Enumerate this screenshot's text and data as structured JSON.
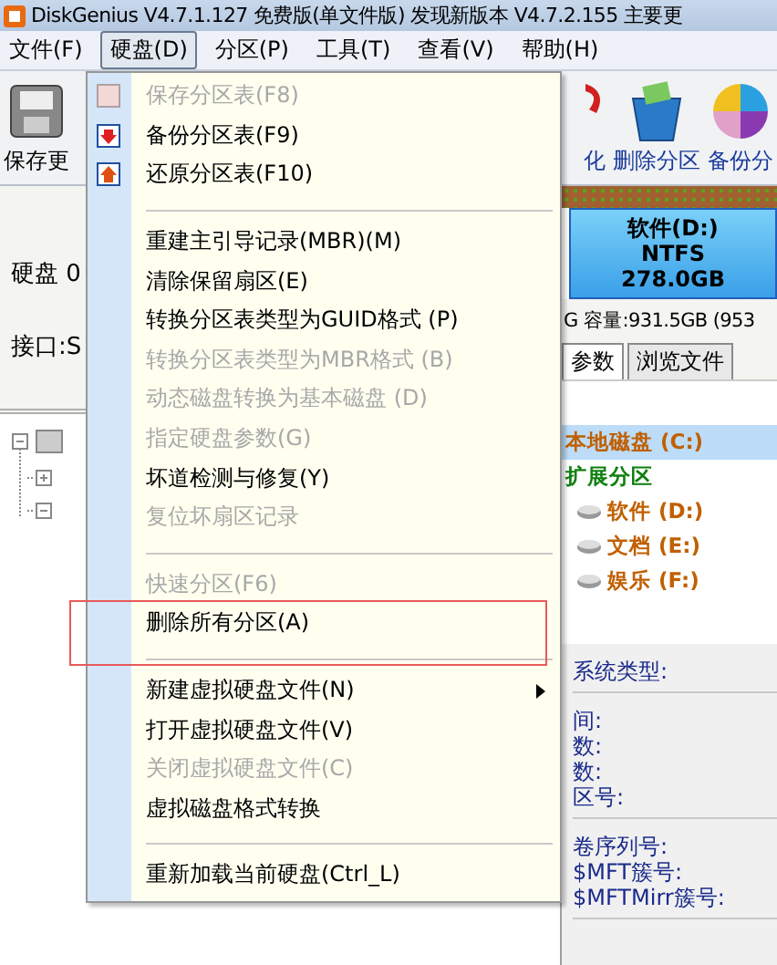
{
  "window": {
    "title": "DiskGenius V4.7.1.127 免费版(单文件版)   发现新版本 V4.7.2.155 主要更"
  },
  "menubar": [
    {
      "label": "文件(F)",
      "selected": false
    },
    {
      "label": "硬盘(D)",
      "selected": true
    },
    {
      "label": "分区(P)",
      "selected": false
    },
    {
      "label": "工具(T)",
      "selected": false
    },
    {
      "label": "查看(V)",
      "selected": false
    },
    {
      "label": "帮助(H)",
      "selected": false
    }
  ],
  "toolbar": {
    "left": [
      {
        "label": "保存更",
        "kind": "save"
      }
    ],
    "right": [
      {
        "label": "化",
        "kind": "format"
      },
      {
        "label": "删除分区",
        "kind": "trash"
      },
      {
        "label": "备份分",
        "kind": "pie"
      }
    ]
  },
  "disk_info": {
    "disk": "硬盘 0",
    "interface": "接口:S"
  },
  "partition_box": {
    "name": "软件(D:)",
    "fs": "NTFS",
    "size": "278.0GB"
  },
  "capacity": "G  容量:931.5GB (953",
  "tabs": [
    {
      "label": "参数",
      "selected": true
    },
    {
      "label": "浏览文件",
      "selected": false
    }
  ],
  "partitions": [
    {
      "label": "本地磁盘 (C:)",
      "kind": "primary",
      "selected": true,
      "color": "#c06000"
    },
    {
      "label": "扩展分区",
      "kind": "extended",
      "selected": false,
      "color": "#108010"
    },
    {
      "label": "软件 (D:)",
      "kind": "logical",
      "selected": false,
      "color": "#c06000"
    },
    {
      "label": "文档 (E:)",
      "kind": "logical",
      "selected": false,
      "color": "#c06000"
    },
    {
      "label": "娱乐 (F:)",
      "kind": "logical",
      "selected": false,
      "color": "#c06000"
    }
  ],
  "info_fields": [
    [
      "系统类型:"
    ],
    [
      "间:",
      "数:",
      "数:",
      "区号:"
    ],
    [
      "卷序列号:",
      "$MFT簇号:",
      "$MFTMirr簇号:"
    ]
  ],
  "menu": [
    {
      "kind": "item",
      "label": "保存分区表(F8)",
      "disabled": true
    },
    {
      "kind": "item",
      "label": "备份分区表(F9)",
      "disabled": false
    },
    {
      "kind": "item",
      "label": "还原分区表(F10)",
      "disabled": false
    },
    {
      "kind": "separator"
    },
    {
      "kind": "item",
      "label": "重建主引导记录(MBR)(M)",
      "disabled": false
    },
    {
      "kind": "item",
      "label": "清除保留扇区(E)",
      "disabled": false
    },
    {
      "kind": "item",
      "label": "转换分区表类型为GUID格式 (P)",
      "disabled": false
    },
    {
      "kind": "item",
      "label": "转换分区表类型为MBR格式 (B)",
      "disabled": true
    },
    {
      "kind": "item",
      "label": "动态磁盘转换为基本磁盘 (D)",
      "disabled": true
    },
    {
      "kind": "item",
      "label": "指定硬盘参数(G)",
      "disabled": true
    },
    {
      "kind": "item",
      "label": "坏道检测与修复(Y)",
      "disabled": false
    },
    {
      "kind": "item",
      "label": "复位坏扇区记录",
      "disabled": true
    },
    {
      "kind": "separator"
    },
    {
      "kind": "item",
      "label": "快速分区(F6)",
      "disabled": true
    },
    {
      "kind": "item",
      "label": "删除所有分区(A)",
      "disabled": false,
      "highlighted": true
    },
    {
      "kind": "separator"
    },
    {
      "kind": "item",
      "label": "新建虚拟硬盘文件(N)",
      "disabled": false,
      "submenu": true
    },
    {
      "kind": "item",
      "label": "打开虚拟硬盘文件(V)",
      "disabled": false
    },
    {
      "kind": "item",
      "label": "关闭虚拟硬盘文件(C)",
      "disabled": true
    },
    {
      "kind": "item",
      "label": "虚拟磁盘格式转换",
      "disabled": false
    },
    {
      "kind": "separator"
    },
    {
      "kind": "item",
      "label": "重新加载当前硬盘(Ctrl_L)",
      "disabled": false
    }
  ]
}
